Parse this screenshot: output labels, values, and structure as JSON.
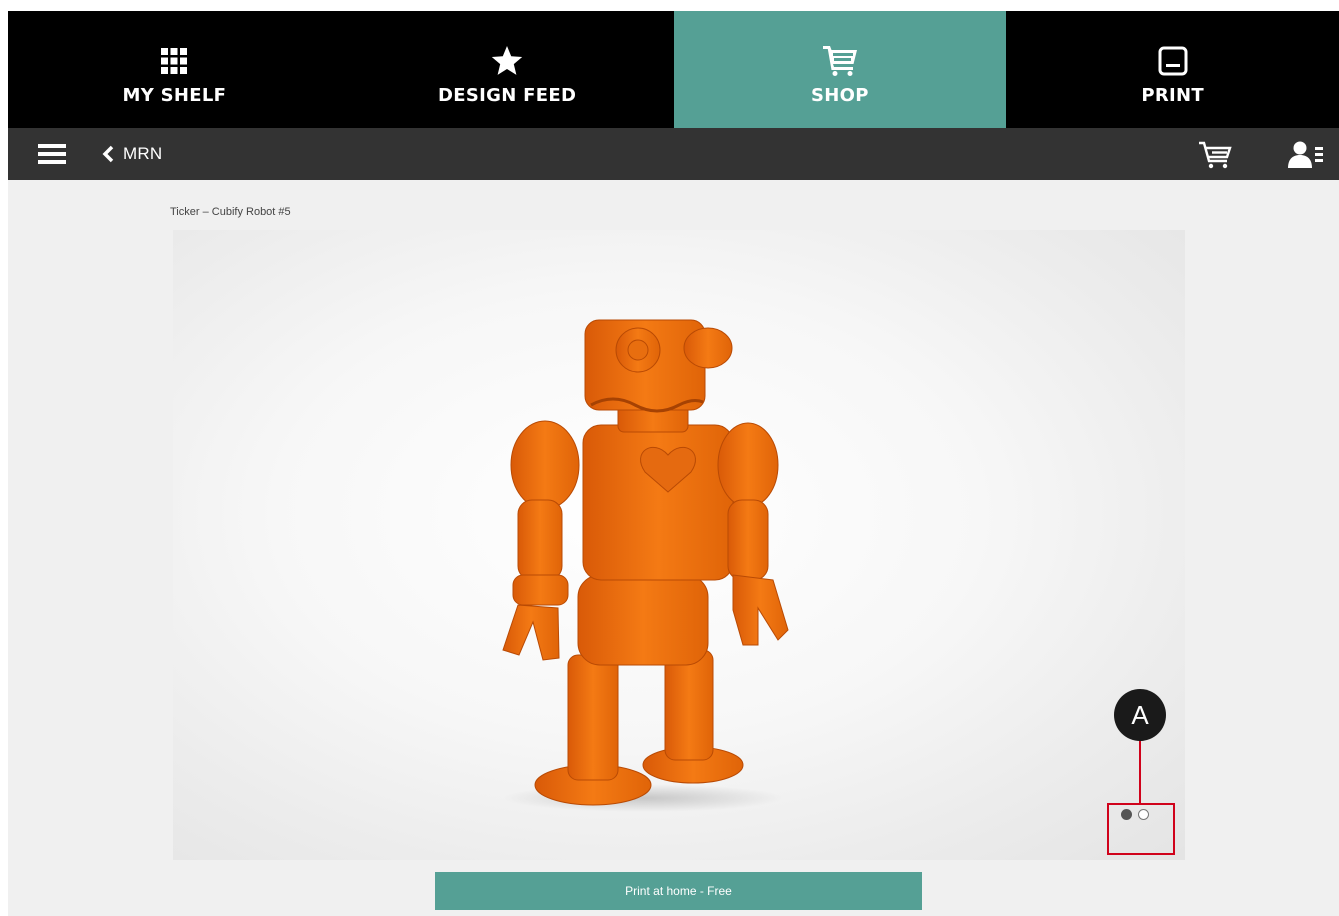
{
  "nav": {
    "tabs": [
      {
        "label": "MY SHELF",
        "icon": "grid-icon"
      },
      {
        "label": "DESIGN FEED",
        "icon": "star-icon"
      },
      {
        "label": "SHOP",
        "icon": "cart-icon"
      },
      {
        "label": "PRINT",
        "icon": "printer-icon"
      }
    ],
    "active_tab": "SHOP"
  },
  "subbar": {
    "menu_icon": "hamburger-menu-icon",
    "back_label": "MRN",
    "cart_icon": "cart-icon",
    "account_icon": "account-icon"
  },
  "product": {
    "title": "Ticker – Cubify Robot #5",
    "image": "orange-3d-printed-robot",
    "carousel": {
      "total": 2,
      "active": 1
    },
    "print_button_label": "Print at home - Free"
  },
  "annotation": {
    "marker": "A"
  },
  "colors": {
    "accent": "#55a095",
    "nav_bg": "#000000",
    "subbar_bg": "#333333",
    "content_bg": "#f0f0f0",
    "callout": "#d0021b",
    "robot": "#f07010"
  }
}
